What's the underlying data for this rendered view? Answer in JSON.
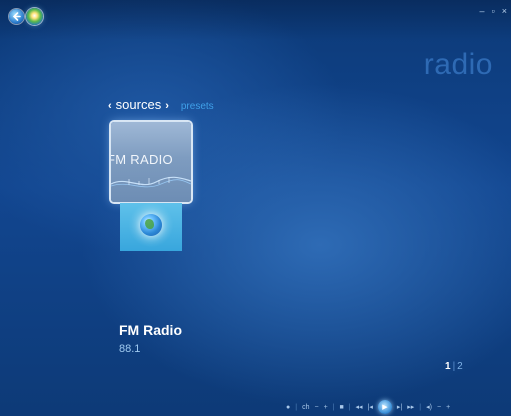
{
  "window": {
    "minimize_label": "–",
    "restore_label": "▫",
    "close_label": "×"
  },
  "header": {
    "title": "radio"
  },
  "nav": {
    "prev_chevron": "‹",
    "current": "sources",
    "next_chevron": "›",
    "other": "presets"
  },
  "tiles": [
    {
      "label": "FM RADIO",
      "icon": "fm-radio-wave-icon"
    },
    {
      "label": "",
      "icon": "internet-globe-icon"
    }
  ],
  "now_playing": {
    "station": "FM Radio",
    "frequency": "88.1"
  },
  "pager": {
    "current": "1",
    "separator": "|",
    "other": "2"
  },
  "transport": {
    "record": "●",
    "ch_label": "ch",
    "ch_down": "−",
    "ch_up": "+",
    "stop": "■",
    "rewind": "◂◂",
    "skip_back": "|◂",
    "play": "▶",
    "skip_forward": "▸|",
    "fast_forward": "▸▸",
    "mute": "◂)",
    "vol_down": "−",
    "vol_up": "+"
  },
  "colors": {
    "background": "#124690",
    "title": "#2e6ab4",
    "accent": "#3fa0e8",
    "text": "#ffffff"
  }
}
